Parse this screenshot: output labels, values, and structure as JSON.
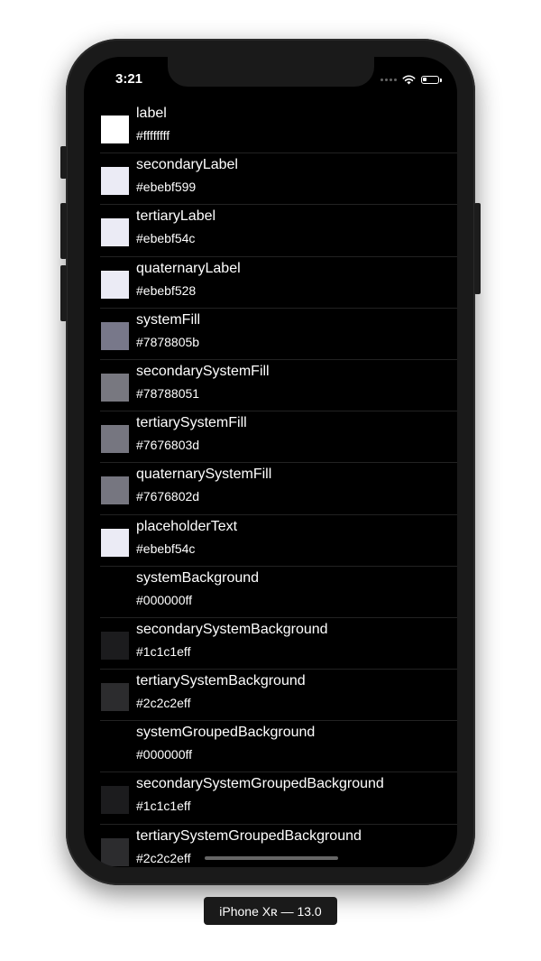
{
  "status_bar": {
    "time": "3:21"
  },
  "colors": [
    {
      "name": "label",
      "hex": "#ffffffff",
      "swatch": "#ffffff"
    },
    {
      "name": "secondaryLabel",
      "hex": "#ebebf599",
      "swatch": "#ebebf5"
    },
    {
      "name": "tertiaryLabel",
      "hex": "#ebebf54c",
      "swatch": "#ebebf5"
    },
    {
      "name": "quaternaryLabel",
      "hex": "#ebebf528",
      "swatch": "#ebebf5"
    },
    {
      "name": "systemFill",
      "hex": "#7878805b",
      "swatch": "#78788a"
    },
    {
      "name": "secondarySystemFill",
      "hex": "#78788051",
      "swatch": "#787880"
    },
    {
      "name": "tertiarySystemFill",
      "hex": "#7676803d",
      "swatch": "#767680"
    },
    {
      "name": "quaternarySystemFill",
      "hex": "#7676802d",
      "swatch": "#767680"
    },
    {
      "name": "placeholderText",
      "hex": "#ebebf54c",
      "swatch": "#ebebf5"
    },
    {
      "name": "systemBackground",
      "hex": "#000000ff",
      "swatch": "#000000"
    },
    {
      "name": "secondarySystemBackground",
      "hex": "#1c1c1eff",
      "swatch": "#1c1c1e"
    },
    {
      "name": "tertiarySystemBackground",
      "hex": "#2c2c2eff",
      "swatch": "#2c2c2e"
    },
    {
      "name": "systemGroupedBackground",
      "hex": "#000000ff",
      "swatch": "#000000"
    },
    {
      "name": "secondarySystemGroupedBackground",
      "hex": "#1c1c1eff",
      "swatch": "#1c1c1e"
    },
    {
      "name": "tertiarySystemGroupedBackground",
      "hex": "#2c2c2eff",
      "swatch": "#2c2c2e"
    }
  ],
  "device_caption": "iPhone Xʀ — 13.0"
}
